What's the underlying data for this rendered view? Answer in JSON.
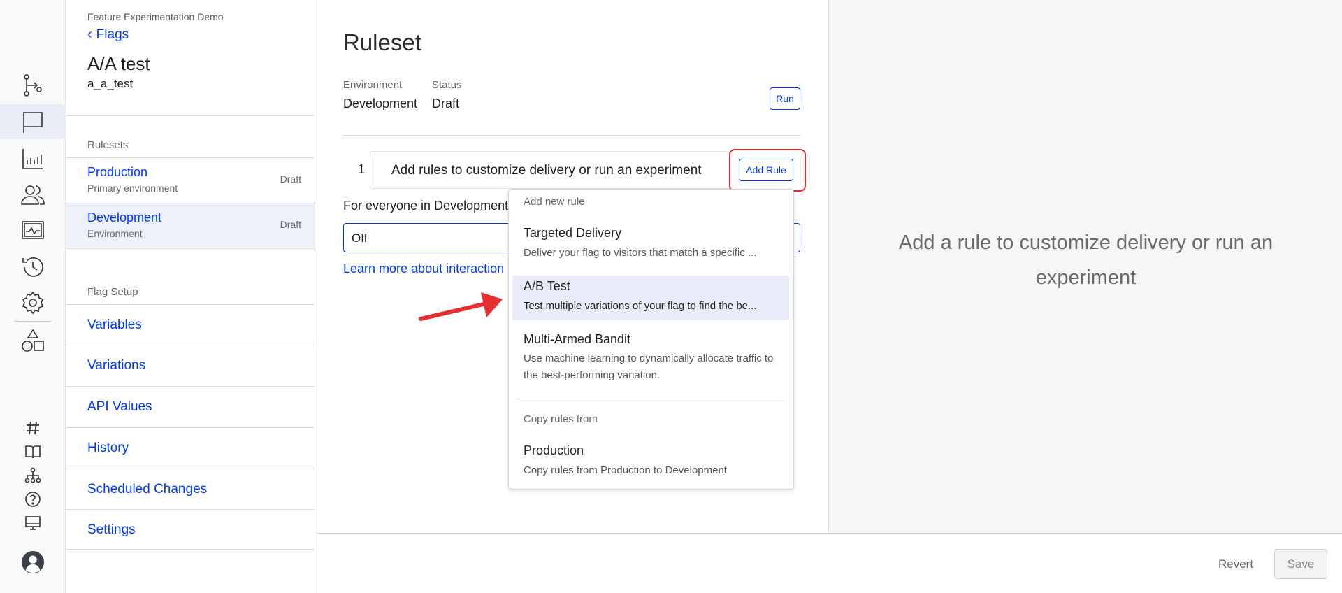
{
  "project_name": "Feature Experimentation Demo",
  "back_link": "Flags",
  "flag": {
    "title": "A/A test",
    "key": "a_a_test"
  },
  "rulesets": {
    "heading": "Rulesets",
    "items": [
      {
        "name": "Production",
        "sub": "Primary environment",
        "status": "Draft"
      },
      {
        "name": "Development",
        "sub": "Environment",
        "status": "Draft"
      }
    ]
  },
  "flag_setup": {
    "heading": "Flag Setup",
    "items": [
      "Variables",
      "Variations",
      "API Values",
      "History",
      "Scheduled Changes",
      "Settings"
    ]
  },
  "main": {
    "title": "Ruleset",
    "environment_label": "Environment",
    "environment_value": "Development",
    "status_label": "Status",
    "status_value": "Draft",
    "run_label": "Run",
    "rule_number": "1",
    "rule_placeholder": "Add rules to customize delivery or run an experiment",
    "add_rule_label": "Add Rule",
    "everyone_text": "For everyone in Development",
    "default_select_value": "Off",
    "learn_more": "Learn more about interaction"
  },
  "dropdown": {
    "new_rule_heading": "Add new rule",
    "options": [
      {
        "title": "Targeted Delivery",
        "desc": "Deliver your flag to visitors that match a specific ..."
      },
      {
        "title": "A/B Test",
        "desc": "Test multiple variations of your flag to find the be..."
      },
      {
        "title": "Multi-Armed Bandit",
        "desc": "Use machine learning to dynamically allocate traffic to the best-performing variation."
      }
    ],
    "copy_heading": "Copy rules from",
    "copy_option": {
      "title": "Production",
      "desc": "Copy rules from Production to Development"
    }
  },
  "right_panel": {
    "message": "Add a rule to customize delivery or run an experiment"
  },
  "footer": {
    "revert": "Revert",
    "save": "Save"
  },
  "colors": {
    "link": "#0037ff",
    "highlight": "#e03030",
    "selected_bg": "#eef1fa"
  },
  "rail_icons": [
    "flow-icon",
    "flag-icon",
    "bar-chart-icon",
    "users-icon",
    "monitor-chart-icon",
    "history-icon",
    "gear-icon",
    "shapes-icon",
    "hash-icon",
    "book-icon",
    "hierarchy-icon",
    "help-icon",
    "desktop-icon",
    "avatar-icon"
  ]
}
